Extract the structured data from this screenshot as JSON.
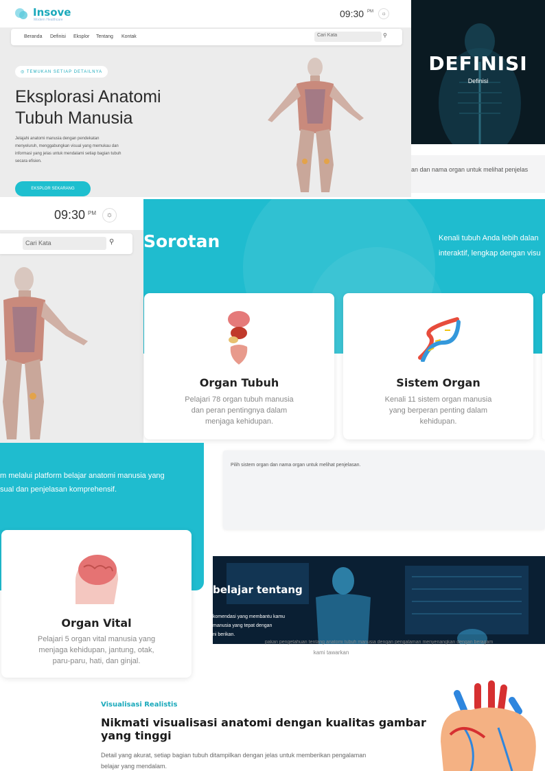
{
  "brand": {
    "name": "Insove",
    "tagline": "Modern Healthcare"
  },
  "clock": {
    "time": "09:30",
    "ampm": "PM"
  },
  "nav": {
    "items": [
      "Beranda",
      "Definisi",
      "Eksplor",
      "Tentang",
      "Kontak"
    ]
  },
  "search": {
    "placeholder": "Cari Kata"
  },
  "hero": {
    "badge": "TEMUKAN SETIAP DETAILNYA",
    "title_line1": "Eksplorasi Anatomi",
    "title_line2": "Tubuh Manusia",
    "desc_lines": [
      "Jelajahi anatomi manusia dengan pendekatan",
      "menyeluruh, menggabungkan visual yang memukau dan",
      "informasi yang jelas untuk mendalami setiap bagian tubuh",
      "secara efisien."
    ],
    "cta": "EKSPLOR SEKARANG"
  },
  "definisi": {
    "title": "DEFINISI",
    "subtitle": "Definisi",
    "partial_text": "an dan nama organ untuk melihat penjelas"
  },
  "sorotan": {
    "title": "Sorotan",
    "intro_line1": "Kenali tubuh Anda lebih dalan",
    "intro_line2": "interaktif, lengkap dengan visu",
    "cont_line1": "m melalui platform belajar anatomi manusia yang",
    "cont_line2": "sual dan penjelasan komprehensif."
  },
  "cards": [
    {
      "title": "Organ Tubuh",
      "lines": [
        "Pelajari 78 organ tubuh manusia",
        "dan peran pentingnya dalam",
        "menjaga kehidupan."
      ],
      "icon": "organs-icon"
    },
    {
      "title": "Sistem Organ",
      "lines": [
        "Kenali 11 sistem organ manusia",
        "yang berperan penting dalam",
        "kehidupan."
      ],
      "icon": "dna-icon"
    },
    {
      "title": "Organ Vital",
      "lines": [
        "Pelajari 5 organ vital manusia yang",
        "menjaga kehidupan, jantung, otak,",
        "paru-paru, hati, dan ginjal."
      ],
      "icon": "brain-icon"
    }
  ],
  "explain": {
    "text": "Pilih sistem organ dan nama organ untuk melihat penjelasan."
  },
  "belajar": {
    "title": "belajar tentang",
    "line1": "komendasi yang membantu kamu",
    "line2": "manusia yang tepat dengan",
    "line3": "ni berikan.",
    "under": "pakan pengetahuan tentang anatomi tubuh manusia dengan pengalaman menyenangkan dengan beragam",
    "under2": "kami tawarkan"
  },
  "visual": {
    "category": "Visualisasi Realistis",
    "title_line1": "Nikmati visualisasi anatomi dengan kualitas gambar",
    "title_line2": "yang tinggi",
    "text_line1": "Detail yang akurat, setiap bagian tubuh ditampilkan dengan jelas untuk memberikan pengalaman",
    "text_line2": "belajar yang mendalam."
  },
  "colors": {
    "accent": "#1fbccf",
    "dark": "#0a1a22"
  }
}
